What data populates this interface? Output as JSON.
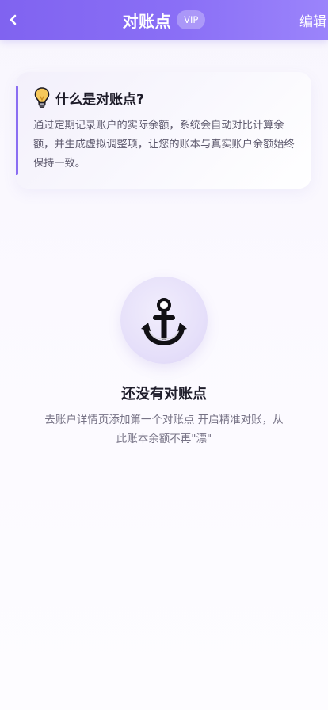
{
  "header": {
    "title": "对账点",
    "badge": "VIP",
    "edit_label": "编辑",
    "back_icon": "chevron-left-icon"
  },
  "info_card": {
    "icon": "lightbulb-icon",
    "title": "什么是对账点?",
    "body": "通过定期记录账户的实际余额，系统会自动对比计算余额，并生成虚拟调整项，让您的账本与真实账户余额始终保持一致。"
  },
  "empty_state": {
    "icon": "anchor-icon",
    "title": "还没有对账点",
    "description": "去账户详情页添加第一个对账点 开启精准对账，从此账本余额不再\"漂\""
  },
  "colors": {
    "header_gradient_start": "#8063f0",
    "header_gradient_end": "#9b84fb",
    "accent": "#8a6df2",
    "bulb": "#f5c451"
  }
}
